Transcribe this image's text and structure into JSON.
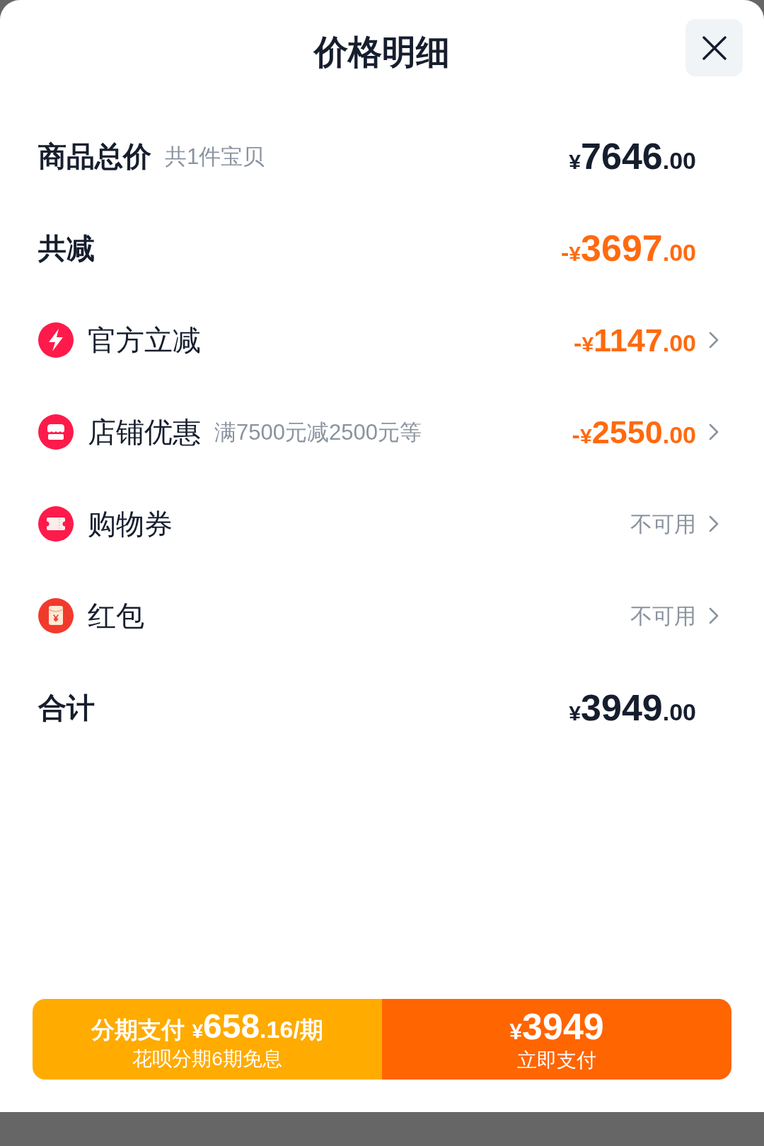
{
  "header": {
    "title": "价格明细"
  },
  "rows": [
    {
      "kind": "total",
      "label": "商品总价",
      "note": "共1件宝贝",
      "amount": {
        "kind": "price",
        "currency": "¥",
        "whole": "7646",
        "cents": ".00",
        "color": "#161e2e"
      }
    },
    {
      "kind": "total",
      "label": "共减",
      "amount": {
        "kind": "price",
        "sign": "-",
        "currency": "¥",
        "whole": "3697",
        "cents": ".00",
        "color": "#ff6a0f"
      }
    },
    {
      "kind": "item",
      "label": "官方立减",
      "amount": {
        "kind": "price",
        "sign": "-",
        "currency": "¥",
        "whole": "1147",
        "cents": ".00",
        "color": "#ff6a0f"
      }
    },
    {
      "kind": "item",
      "label": "店铺优惠",
      "note": "满7500元减2500元等",
      "amount": {
        "kind": "price",
        "sign": "-",
        "currency": "¥",
        "whole": "2550",
        "cents": ".00",
        "color": "#ff6a0f"
      }
    },
    {
      "kind": "item",
      "label": "购物券",
      "amount": {
        "kind": "text",
        "text": "不可用"
      }
    },
    {
      "kind": "item",
      "label": "红包",
      "amount": {
        "kind": "text",
        "text": "不可用"
      }
    },
    {
      "kind": "total",
      "label": "合计",
      "amount": {
        "kind": "price",
        "currency": "¥",
        "whole": "3949",
        "cents": ".00",
        "color": "#161e2e"
      }
    }
  ],
  "footer": {
    "installment": {
      "label": "分期支付",
      "currency": "¥",
      "whole": "658",
      "cents": ".16",
      "unit": "/期",
      "detail": "花呗分期6期免息"
    },
    "pay": {
      "currency": "¥",
      "whole": "3949",
      "label": "立即支付"
    }
  }
}
